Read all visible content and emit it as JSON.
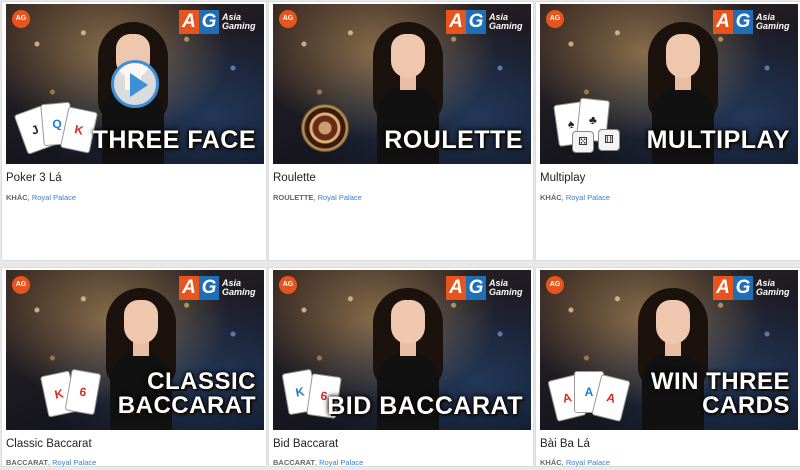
{
  "logo": {
    "a": "A",
    "g": "G",
    "text": "Asia Gaming"
  },
  "badge": "AG",
  "games": [
    {
      "name": "Poker 3 Lá",
      "category": "KHÁC",
      "provider": "Royal Palace",
      "title_lines": [
        "THREE FACE"
      ],
      "cards": [
        "J",
        "Q",
        "K"
      ]
    },
    {
      "name": "Roulette",
      "category": "ROULETTE",
      "provider": "Royal Palace",
      "title_lines": [
        "ROULETTE"
      ]
    },
    {
      "name": "Multiplay",
      "category": "KHÁC",
      "provider": "Royal Palace",
      "title_lines": [
        "MULTIPLAY"
      ],
      "cards": [
        "♠",
        "♣"
      ]
    },
    {
      "name": "Classic Baccarat",
      "category": "BACCARAT",
      "provider": "Royal Palace",
      "title_lines": [
        "CLASSIC",
        "BACCARAT"
      ],
      "cards": [
        "K",
        "6"
      ]
    },
    {
      "name": "Bid Baccarat",
      "category": "BACCARAT",
      "provider": "Royal Palace",
      "title_lines": [
        "BID BACCARAT"
      ],
      "cards": [
        "K",
        "6"
      ]
    },
    {
      "name": "Bài Ba Lá",
      "category": "KHÁC",
      "provider": "Royal Palace",
      "title_lines": [
        "WIN THREE",
        "CARDS"
      ],
      "cards": [
        "A",
        "A",
        "A"
      ]
    }
  ],
  "meta_separator": ", ",
  "colors": {
    "orange": "#e8541d",
    "blue": "#1e6fb8",
    "link": "#3a7fc7"
  },
  "icons": {
    "play": "play-icon"
  }
}
